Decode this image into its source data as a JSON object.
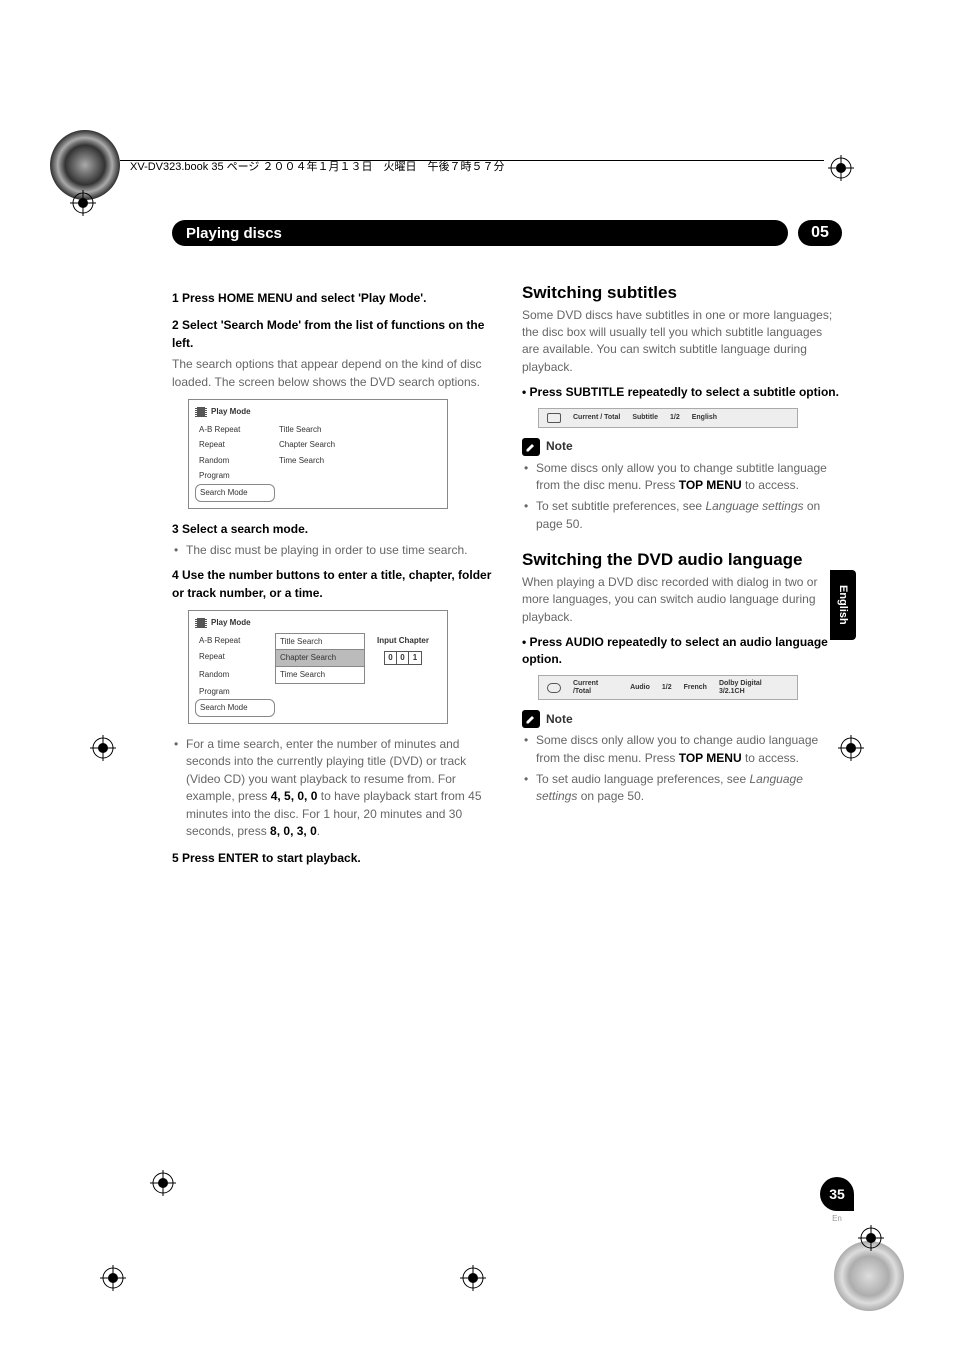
{
  "header_line": "XV-DV323.book 35 ページ ２００４年１月１３日　火曜日　午後７時５７分",
  "titlebar": {
    "title": "Playing discs",
    "chapter": "05"
  },
  "side_tab": "English",
  "page_number": "35",
  "page_lang": "En",
  "left": {
    "step1": "1   Press HOME MENU and select 'Play Mode'.",
    "step2": "2   Select 'Search Mode' from the list of functions on the left.",
    "step2_body": "The search options that appear depend on the kind of disc loaded. The screen below shows the DVD search options.",
    "screen1": {
      "title": "Play Mode",
      "left_items": [
        "A-B Repeat",
        "Repeat",
        "Random",
        "Program",
        "Search Mode"
      ],
      "mid_items": [
        "Title Search",
        "Chapter Search",
        "Time Search"
      ],
      "selected_left": "Search Mode"
    },
    "step3": "3   Select a search mode.",
    "step3_bullet": "The disc must be playing in order to use time search.",
    "step4": "4   Use the number buttons to enter a title, chapter, folder or track number, or a time.",
    "screen2": {
      "title": "Play Mode",
      "left_items": [
        "A-B Repeat",
        "Repeat",
        "Random",
        "Program",
        "Search Mode"
      ],
      "mid_items": [
        "Title Search",
        "Chapter Search",
        "Time Search"
      ],
      "selected_mid": "Chapter Search",
      "right_label": "Input Chapter",
      "digits": [
        "0",
        "0",
        "1"
      ]
    },
    "bullet_time_a": "For a time search, enter the number of minutes and seconds into the currently playing title (DVD) or track (Video CD) you want playback to resume from. For example, press ",
    "bullet_time_keys1": "4, 5, 0, 0",
    "bullet_time_b": " to have playback start from 45 minutes into the disc. For 1 hour, 20 minutes and 30 seconds, press ",
    "bullet_time_keys2": "8, 0, 3, 0",
    "bullet_time_c": ".",
    "step5": "5   Press ENTER to start playback."
  },
  "right": {
    "h_subs": "Switching subtitles",
    "subs_body": "Some DVD discs have subtitles in one or more languages; the disc box will usually tell you which subtitle languages are available. You can switch subtitle language during playback.",
    "subs_action": "•   Press SUBTITLE repeatedly to select a subtitle option.",
    "subs_osd": {
      "label": "Subtitle",
      "ct_label": "Current / Total",
      "ct": "1/2",
      "lang": "English"
    },
    "note_label": "Note",
    "subs_note1_a": "Some discs only allow you to change subtitle language from the disc menu. Press ",
    "subs_note1_b": "TOP MENU",
    "subs_note1_c": " to access.",
    "subs_note2_a": "To set subtitle preferences, see ",
    "subs_note2_b": "Language settings",
    "subs_note2_c": " on page 50.",
    "h_audio": "Switching the DVD audio language",
    "audio_body": "When playing a DVD disc recorded with dialog in two or more languages, you can switch audio language during playback.",
    "audio_action": "•   Press AUDIO repeatedly to select an audio language option.",
    "audio_osd": {
      "label": "Audio",
      "ct_label": "Current /Total",
      "ct": "1/2",
      "lang": "French",
      "codec": "Dolby Digital 3/2.1CH"
    },
    "audio_note1_a": "Some discs only allow you to change audio language from the disc menu. Press ",
    "audio_note1_b": "TOP MENU",
    "audio_note1_c": " to access.",
    "audio_note2_a": "To set audio language preferences, see ",
    "audio_note2_b": "Language settings",
    "audio_note2_c": " on page 50."
  }
}
